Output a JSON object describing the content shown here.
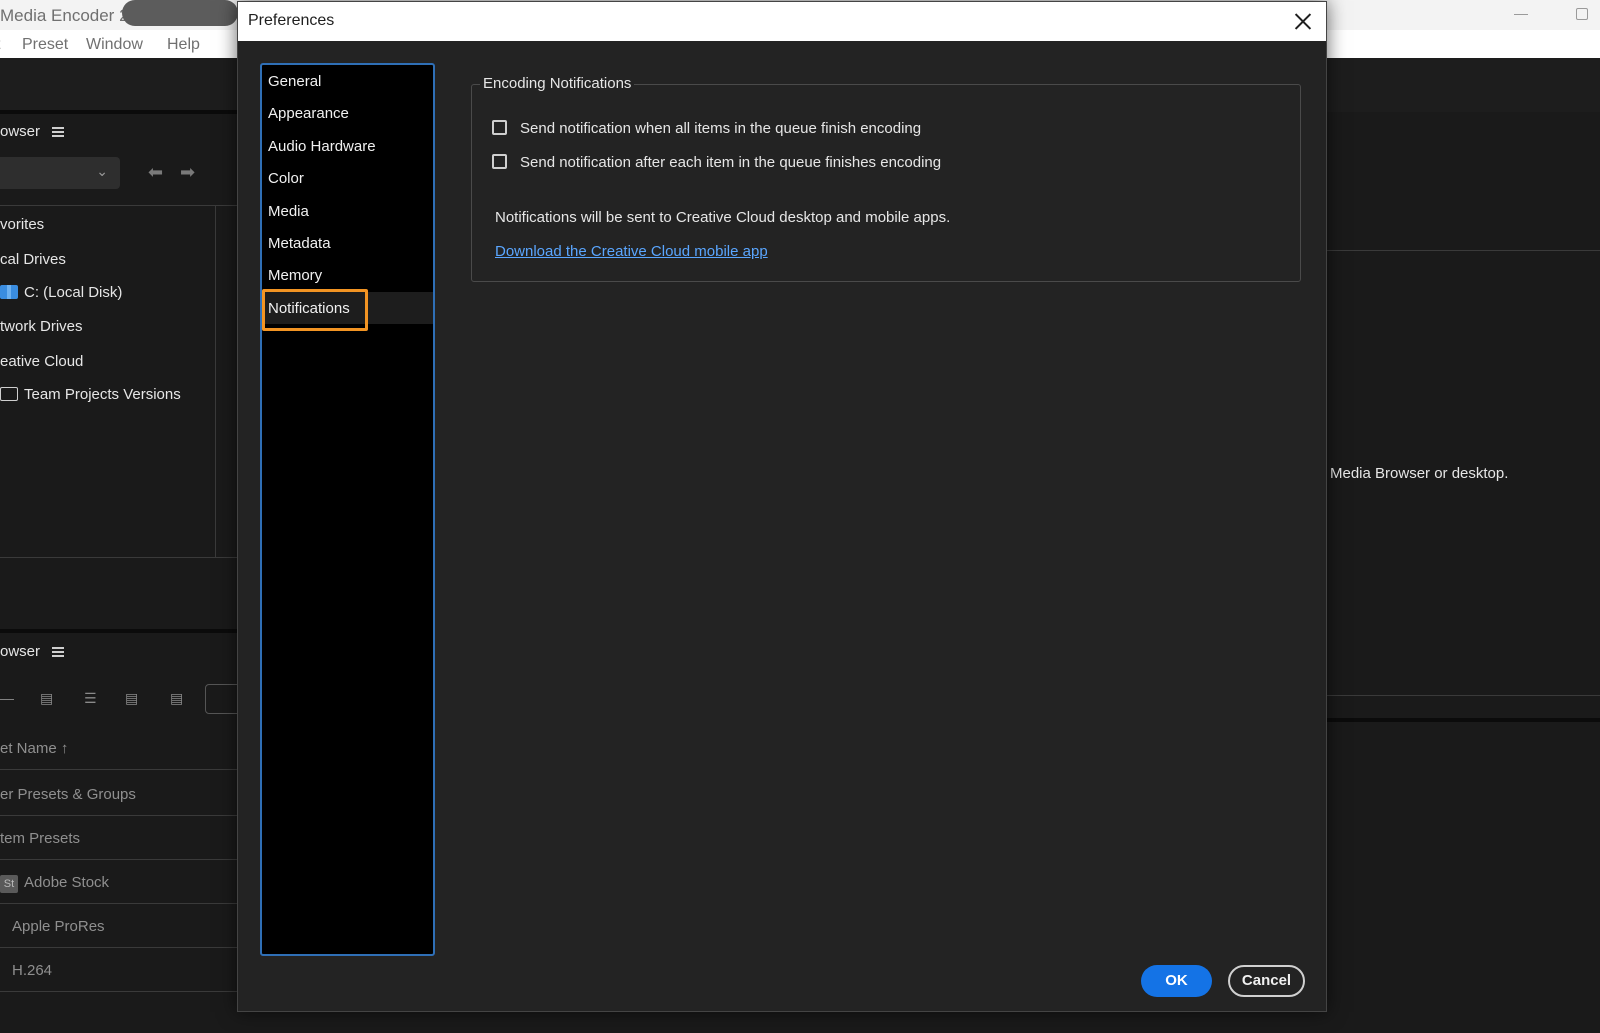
{
  "app": {
    "title": "Media Encoder 2",
    "menu": [
      "t",
      "Preset",
      "Window",
      "Help"
    ]
  },
  "background": {
    "media_browser_header": "owser",
    "media_tree": [
      {
        "label": "vorites",
        "icon": ""
      },
      {
        "label": "cal Drives",
        "icon": ""
      },
      {
        "label": "C: (Local Disk)",
        "icon": "disk-icon"
      },
      {
        "label": "twork Drives",
        "icon": ""
      },
      {
        "label": "eative Cloud",
        "icon": ""
      },
      {
        "label": "Team Projects Versions",
        "icon": "team-projects-icon"
      }
    ],
    "preset_browser_header": "owser",
    "preset_column_header": "et Name",
    "preset_rows": [
      {
        "label": "er Presets & Groups"
      },
      {
        "label": "tem Presets"
      },
      {
        "label": "Adobe Stock",
        "badge": "St"
      },
      {
        "label": "Apple ProRes"
      },
      {
        "label": "H.264"
      }
    ],
    "right_panel_text": "Media Browser or desktop."
  },
  "dialog": {
    "title": "Preferences",
    "categories": [
      "General",
      "Appearance",
      "Audio Hardware",
      "Color",
      "Media",
      "Metadata",
      "Memory",
      "Notifications"
    ],
    "selected_category": "Notifications",
    "section_title": "Encoding Notifications",
    "checkbox_all_label": "Send notification when all items in the queue finish encoding",
    "checkbox_each_label": "Send notification after each item in the queue finishes encoding",
    "checkbox_all_checked": false,
    "checkbox_each_checked": false,
    "info_text": "Notifications will be sent to Creative Cloud desktop and mobile apps.",
    "link_text": "Download the Creative Cloud mobile app",
    "ok_label": "OK",
    "cancel_label": "Cancel",
    "colors": {
      "accent_blue": "#1473e6",
      "highlight_orange": "#f29423",
      "link_blue": "#5aa6ff"
    }
  }
}
